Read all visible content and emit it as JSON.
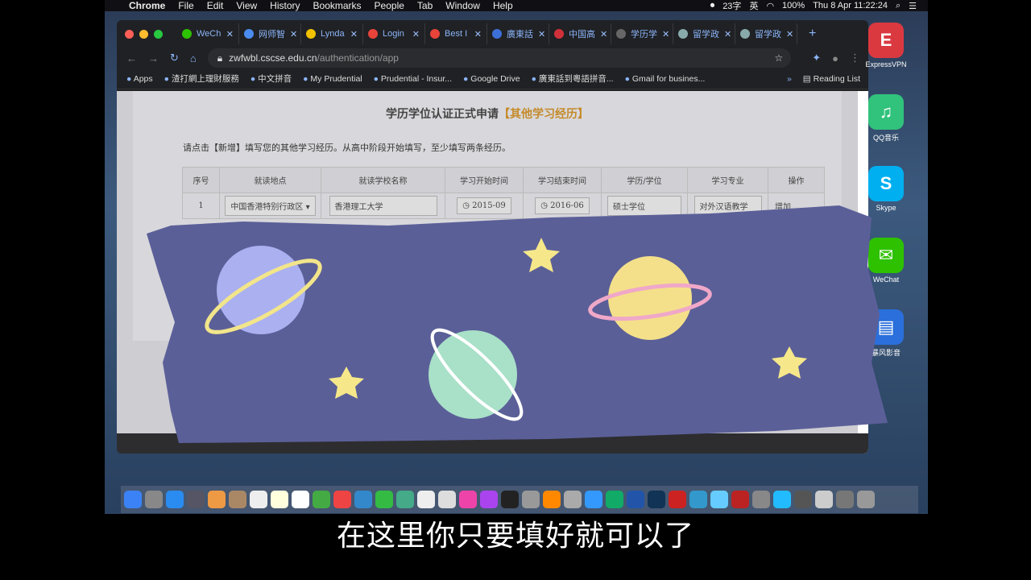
{
  "menubar": {
    "app": "Chrome",
    "items": [
      "File",
      "Edit",
      "View",
      "History",
      "Bookmarks",
      "People",
      "Tab",
      "Window",
      "Help"
    ],
    "status": {
      "input_count": "23字",
      "ime": "英",
      "battery": "100%",
      "datetime": "Thu 8 Apr  11:22:24"
    }
  },
  "browser": {
    "tabs": [
      {
        "label": "WeCh",
        "color": "#2dc100"
      },
      {
        "label": "网师智",
        "color": "#4a8cf0"
      },
      {
        "label": "Lynda",
        "color": "#f2c200"
      },
      {
        "label": "Login",
        "color": "#e8443a"
      },
      {
        "label": "Best I",
        "color": "#e8443a"
      },
      {
        "label": "廣東話",
        "color": "#3d6fd8"
      },
      {
        "label": "中国高",
        "color": "#d0303a"
      },
      {
        "label": "学历学",
        "color": "#666666"
      },
      {
        "label": "留学政",
        "color": "#8aa"
      },
      {
        "label": "留学政",
        "color": "#8aa"
      }
    ],
    "url_host": "zwfwbl.cscse.edu.cn",
    "url_path": "/authentication/app",
    "bookmarks": [
      "Apps",
      "渣打網上理財服務",
      "中文拼音",
      "My Prudential",
      "Prudential - Insur...",
      "Google Drive",
      "廣東話到粵語拼音...",
      "Gmail for busines..."
    ],
    "reading_list": "Reading List"
  },
  "page": {
    "title": "学历学位认证正式申请",
    "title_highlight": "【其他学习经历】",
    "hint": "请点击【新增】填写您的其他学习经历。从高中阶段开始填写，至少填写两条经历。",
    "table": {
      "headers": [
        "序号",
        "就读地点",
        "就读学校名称",
        "学习开始时间",
        "学习结束时间",
        "学历/学位",
        "学习专业",
        "操作"
      ],
      "rows": [
        {
          "index": "1",
          "location": "中国香港特别行政区",
          "school": "香港理工大学",
          "start": "2015-09",
          "end": "2016-06",
          "degree": "硕士学位",
          "major": "对外汉语教学",
          "action": "增加"
        }
      ]
    }
  },
  "desktop": [
    {
      "label": "ExpressVPN",
      "color": "#da3940",
      "glyph": "E"
    },
    {
      "label": "QQ音乐",
      "color": "#31c27c",
      "glyph": "♫"
    },
    {
      "label": "Skype",
      "color": "#00aff0",
      "glyph": "S"
    },
    {
      "label": "WeChat",
      "color": "#2dc100",
      "glyph": "✉"
    },
    {
      "label": "暴风影音",
      "color": "#2a6fdb",
      "glyph": "▤"
    }
  ],
  "subtitle": "在这里你只要填好就可以了"
}
